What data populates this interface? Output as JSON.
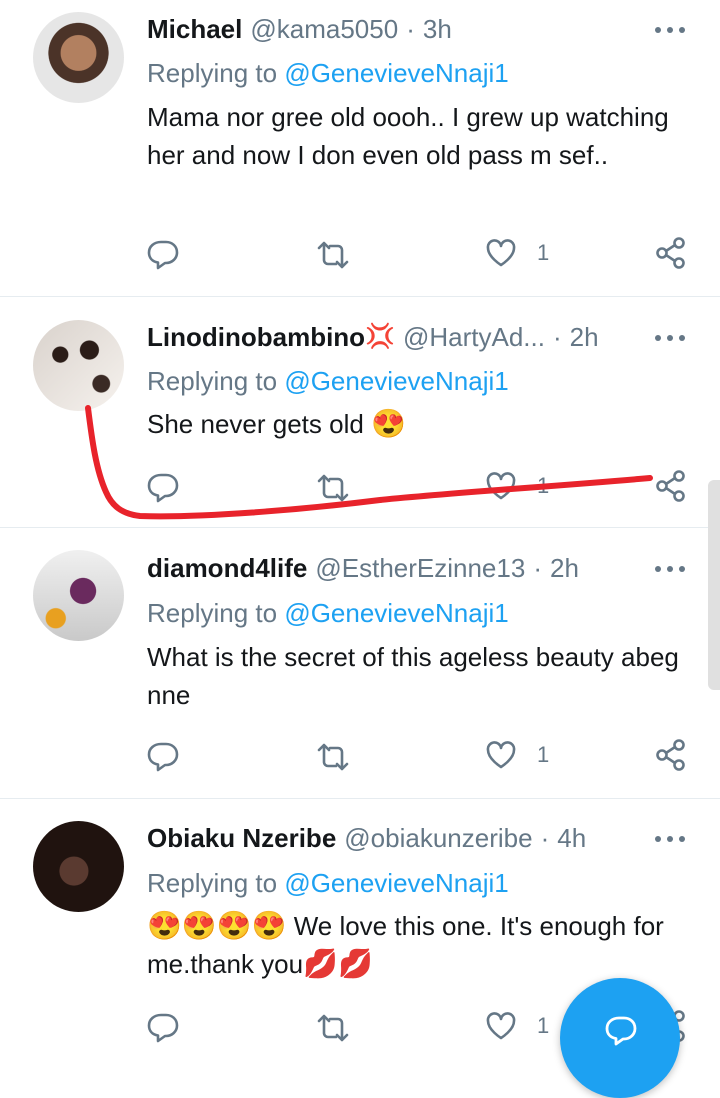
{
  "reply_prefix": "Replying to",
  "tweets": [
    {
      "name": "Michael",
      "handle": "@kama5050",
      "separator": "·",
      "time": "3h",
      "replying_to": "@GenevieveNnaji1",
      "text": "Mama nor gree old oooh.. I grew up watching her and now I don even old pass m sef..",
      "like_count": "1"
    },
    {
      "name": "Linodinobambino",
      "name_emoji": "💢",
      "handle": "@HartyAd...",
      "separator": "·",
      "time": "2h",
      "replying_to": "@GenevieveNnaji1",
      "text": "She never gets old",
      "text_emoji": "😍",
      "like_count": "1"
    },
    {
      "name": "diamond4life",
      "handle": "@EstherEzinne13",
      "separator": "·",
      "time": "2h",
      "replying_to": "@GenevieveNnaji1",
      "text": "What is the secret of this ageless beauty abeg nne",
      "like_count": "1"
    },
    {
      "name": "Obiaku Nzeribe",
      "handle": "@obiakunzeribe",
      "separator": "·",
      "time": "4h",
      "replying_to": "@GenevieveNnaji1",
      "text_emoji_lead": "😍😍😍😍",
      "text": "We love this one. It's enough for me.thank you",
      "text_emoji_tail": "💋💋",
      "like_count": "1"
    }
  ],
  "icons": {
    "reply": "reply-icon",
    "retweet": "retweet-icon",
    "like": "heart-icon",
    "share": "share-icon",
    "more": "more-icon",
    "compose": "compose-reply-icon"
  },
  "colors": {
    "accent": "#1da1f2",
    "secondary_text": "#657786",
    "annotation": "#e8232b"
  }
}
